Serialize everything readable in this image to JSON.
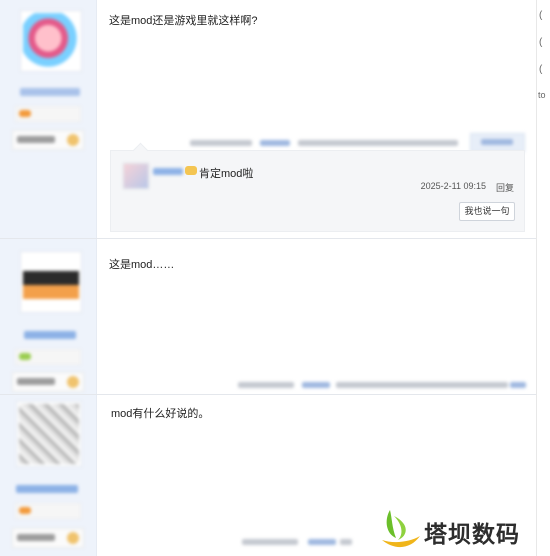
{
  "posts": [
    {
      "text": "这是mod还是游戏里就这样啊?"
    },
    {
      "text": "这是mod……"
    },
    {
      "text": "mod有什么好说的。"
    }
  ],
  "reply": {
    "text": "肯定mod啦",
    "time": "2025-2-11 09:15",
    "reply_label": "回复",
    "button": "我也说一句"
  },
  "right_panel": {
    "chars": [
      "(",
      "(",
      "(",
      "to"
    ]
  },
  "watermark": {
    "text": "塔坝数码"
  },
  "colors": {
    "link_blue": "#8db2e6",
    "sidebar_bg": "#eef3fb",
    "logo_green": "#6bbf2a",
    "logo_yellow": "#f0b51a"
  }
}
